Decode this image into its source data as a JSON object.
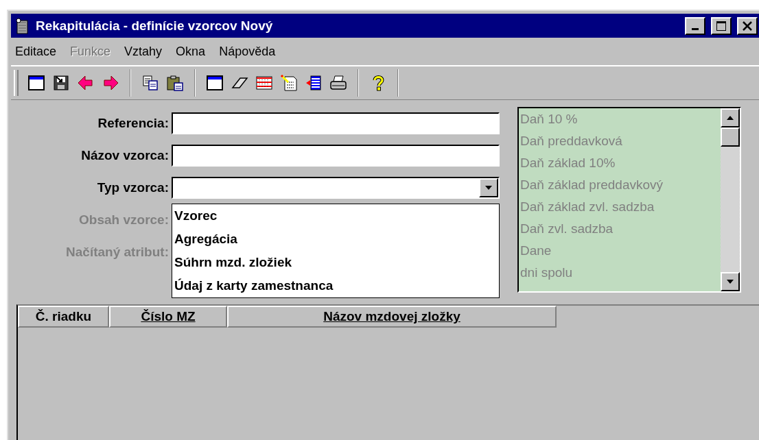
{
  "window": {
    "title": "Rekapitulácia - definície vzorcov Nový"
  },
  "menu": [
    {
      "label": "Editace",
      "disabled": false
    },
    {
      "label": "Funkce",
      "disabled": true
    },
    {
      "label": "Vztahy",
      "disabled": false
    },
    {
      "label": "Okna",
      "disabled": false
    },
    {
      "label": "Nápověda",
      "disabled": false
    }
  ],
  "form": {
    "fields": [
      {
        "label": "Referencia:",
        "kind": "text",
        "disabled": false
      },
      {
        "label": "Názov vzorca:",
        "kind": "text",
        "disabled": false
      },
      {
        "label": "Typ vzorca:",
        "kind": "combo",
        "disabled": false,
        "expanded": true,
        "options": [
          "Vzorec",
          "Agregácia",
          "Súhrn mzd. zložiek",
          "Údaj z karty zamestnanca"
        ]
      },
      {
        "label": "Obsah vzorce:",
        "kind": "text",
        "disabled": true
      },
      {
        "label": "Načítaný atribut:",
        "kind": "text",
        "disabled": true
      }
    ]
  },
  "list": {
    "disabled": true,
    "items": [
      "Daň 10 %",
      "Daň preddavková",
      "Daň základ 10%",
      "Daň základ preddavkový",
      "Daň základ zvl. sadzba",
      "Daň zvl. sadzba",
      "Dane",
      "dni spolu"
    ]
  },
  "table": {
    "columns": [
      {
        "label": "Č. riadku",
        "underlined": false
      },
      {
        "label": "Číslo MZ",
        "underlined": true
      },
      {
        "label": "Názov mzdovej zložky",
        "underlined": true
      }
    ]
  }
}
